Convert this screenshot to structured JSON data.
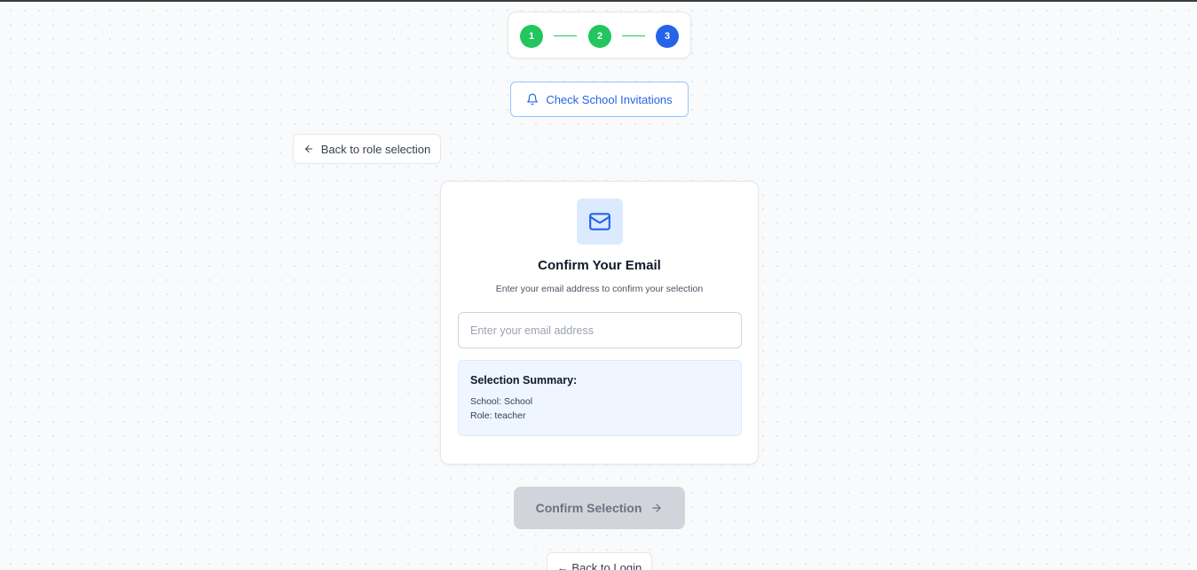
{
  "stepper": {
    "steps": [
      {
        "label": "1",
        "status": "done"
      },
      {
        "label": "2",
        "status": "done"
      },
      {
        "label": "3",
        "status": "active"
      }
    ]
  },
  "invitations": {
    "label": "Check School Invitations",
    "icon": "bell-icon"
  },
  "back_role": {
    "label": "Back to role selection",
    "icon": "arrow-left-icon"
  },
  "card": {
    "icon": "mail-icon",
    "title": "Confirm Your Email",
    "subtitle": "Enter your email address to confirm your selection",
    "email_input": {
      "placeholder": "Enter your email address",
      "value": ""
    },
    "summary": {
      "title": "Selection Summary:",
      "school_line": "School: School",
      "role_line": "Role: teacher"
    }
  },
  "confirm": {
    "label": "Confirm Selection",
    "icon": "arrow-right-icon",
    "disabled": true
  },
  "back_login": {
    "label": "← Back to Login"
  },
  "colors": {
    "accent": "#2563eb",
    "success": "#22c55e",
    "disabled_bg": "#d1d5db",
    "summary_bg": "#eff6ff"
  }
}
